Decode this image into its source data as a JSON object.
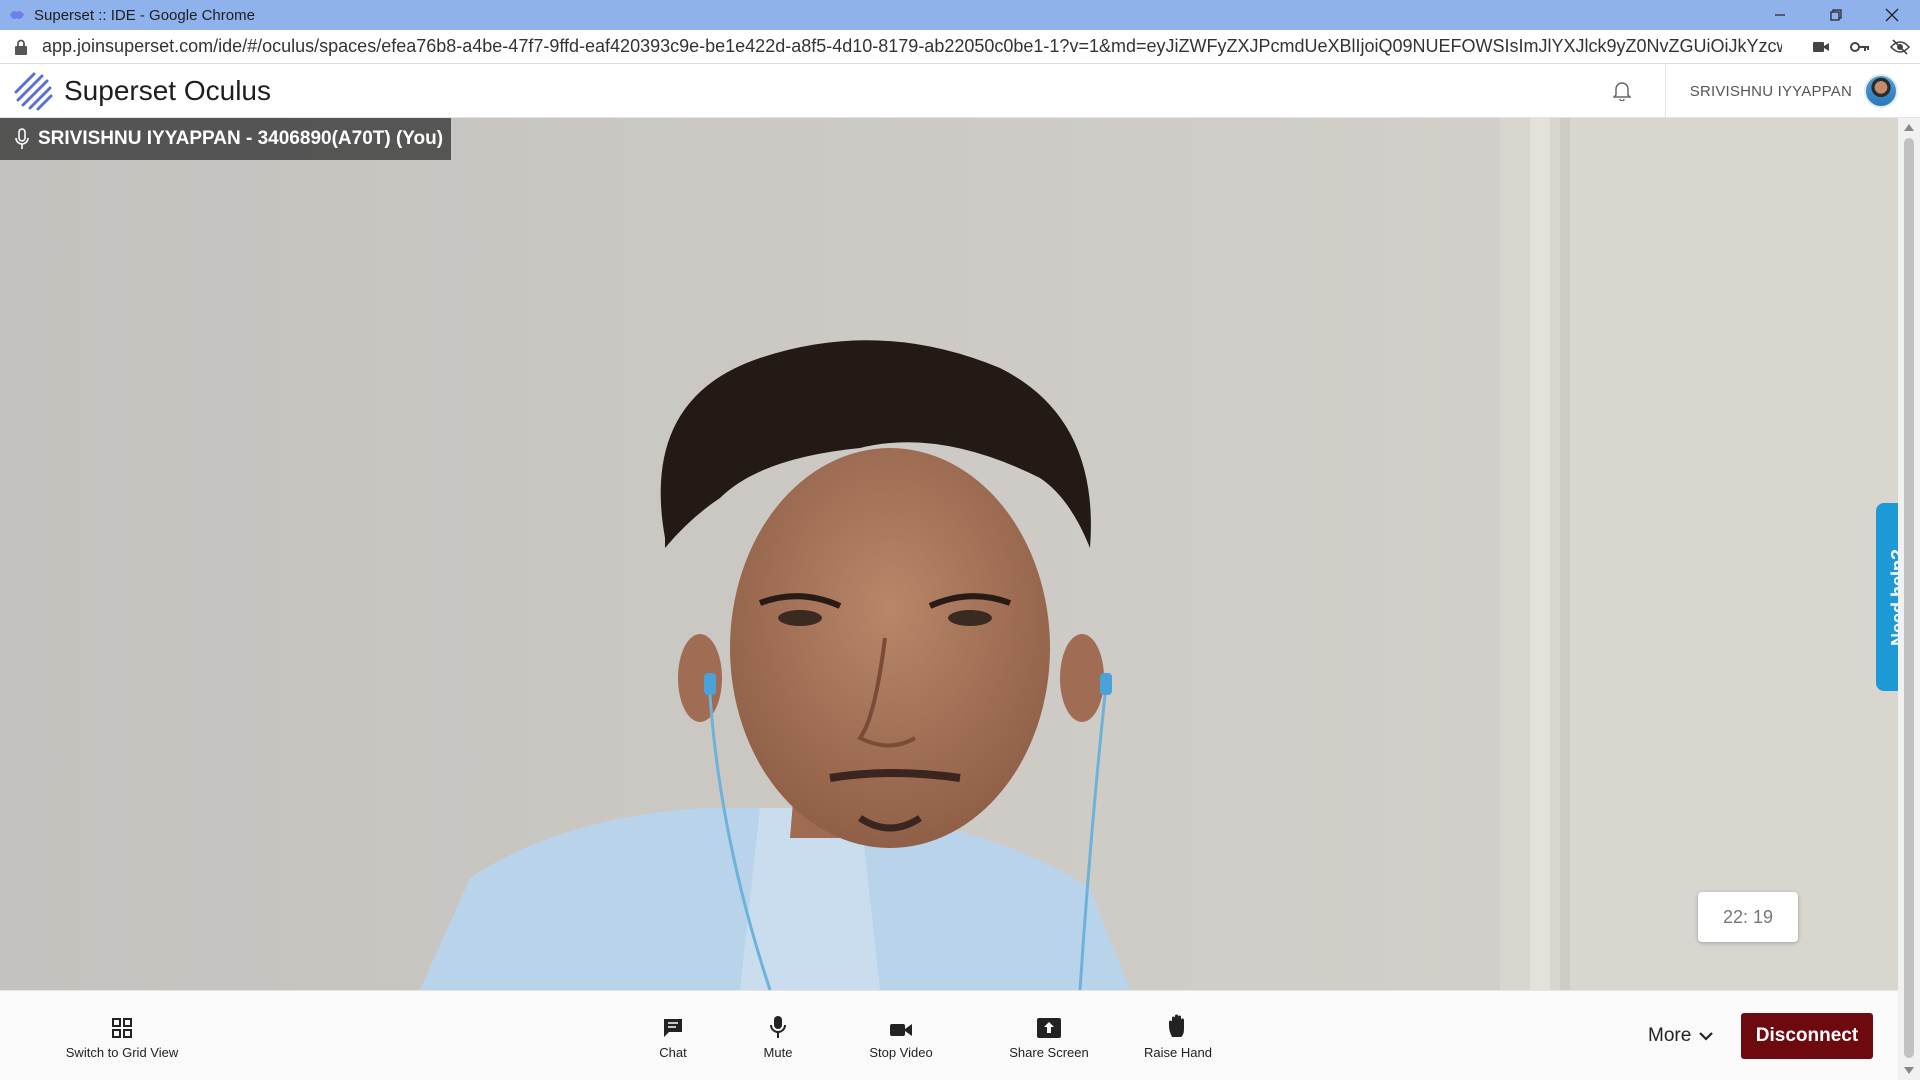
{
  "browser": {
    "title": "Superset :: IDE - Google Chrome",
    "url": "app.joinsuperset.com/ide/#/oculus/spaces/efea76b8-a4be-47f7-9ffd-eaf420393c9e-be1e422d-a8f5-4d10-8179-ab22050c0be1-1?v=1&md=eyJiZWFyZXJPcmdUeXBlIjoiQ09NUEFOWSIsImJlYXJlck9yZ0NvZGUiOiJkYzcwZWY1Ny..."
  },
  "app": {
    "brand": "Superset Oculus",
    "user_name": "SRIVISHNU IYYAPPAN"
  },
  "stage": {
    "participant_label": "SRIVISHNU IYYAPPAN - 3406890(A70T) (You)",
    "timer": "22: 19",
    "help_label": "Need help?"
  },
  "controls": {
    "grid_view": "Switch to Grid View",
    "chat": "Chat",
    "mute": "Mute",
    "stop_video": "Stop Video",
    "share_screen": "Share Screen",
    "raise_hand": "Raise Hand",
    "more": "More",
    "disconnect": "Disconnect"
  },
  "colors": {
    "titlebar": "#8fb1ec",
    "help_tab": "#1d9ad6",
    "disconnect": "#6e0a0f"
  }
}
